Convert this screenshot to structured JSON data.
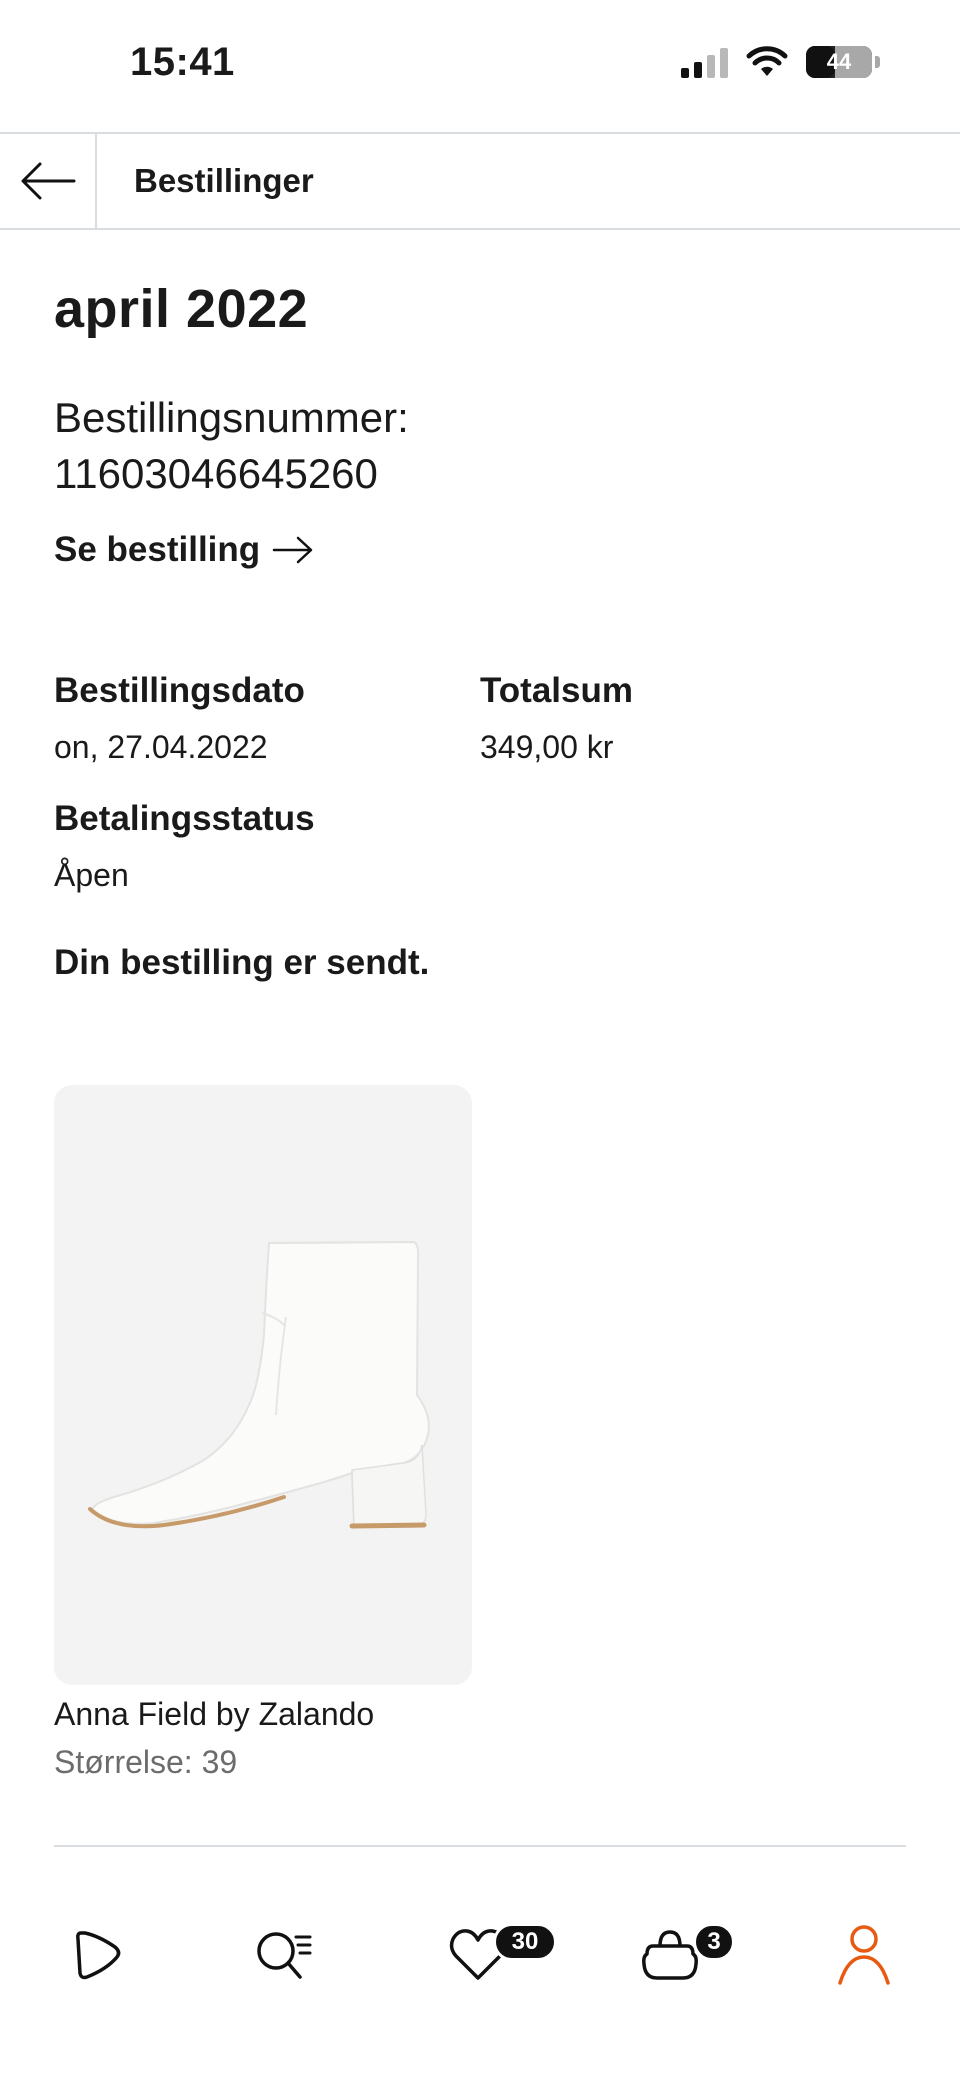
{
  "status_bar": {
    "time": "15:41",
    "battery": "44"
  },
  "header": {
    "title": "Bestillinger"
  },
  "order": {
    "month": "april 2022",
    "number_label": "Bestillingsnummer:",
    "number": "11603046645260",
    "see_order_label": "Se bestilling",
    "date_label": "Bestillingsdato",
    "date_value": "on, 27.04.2022",
    "total_label": "Totalsum",
    "total_value": "349,00 kr",
    "payment_label": "Betalingsstatus",
    "payment_value": "Åpen",
    "shipped_message": "Din bestilling er sendt."
  },
  "product": {
    "brand": "Anna Field by Zalando",
    "size": "Størrelse: 39"
  },
  "tabbar": {
    "items": [
      {
        "name": "home",
        "icon": "play-icon"
      },
      {
        "name": "search",
        "icon": "search-icon"
      },
      {
        "name": "wishlist",
        "icon": "heart-icon",
        "badge": "30"
      },
      {
        "name": "bag",
        "icon": "bag-icon",
        "badge": "3"
      },
      {
        "name": "profile",
        "icon": "user-icon",
        "active": true
      }
    ]
  },
  "colors": {
    "accent": "#e85a10",
    "divider": "#d9dde2",
    "text": "#1a1a1a",
    "muted": "#6c6c6c",
    "card_bg": "#f3f3f3"
  }
}
